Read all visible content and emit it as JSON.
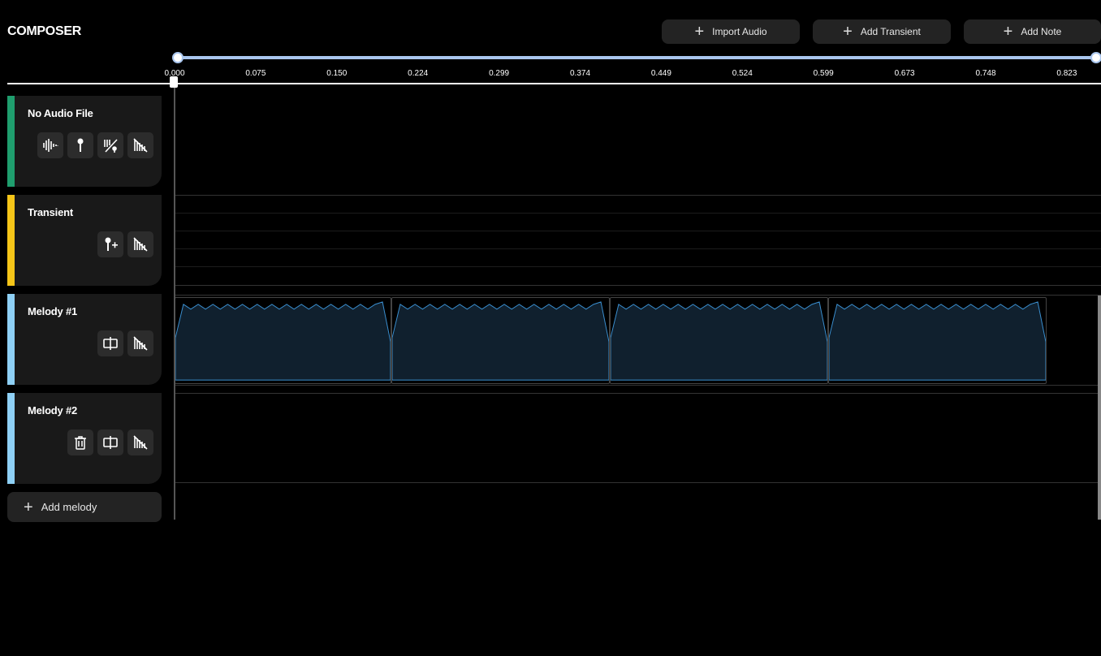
{
  "app": {
    "title": "COMPOSER"
  },
  "toolbar": {
    "import_audio": "Import Audio",
    "add_transient": "Add Transient",
    "add_note": "Add Note"
  },
  "timeline": {
    "ticks": [
      "0.000",
      "0.075",
      "0.150",
      "0.224",
      "0.299",
      "0.374",
      "0.449",
      "0.524",
      "0.599",
      "0.673",
      "0.748",
      "0.823"
    ]
  },
  "tracks": [
    {
      "name": "No Audio File",
      "color": "#1f9e6e",
      "icons": [
        "waveform-icon",
        "transient-pin-icon",
        "waveform-transient-icon",
        "mute-icon"
      ]
    },
    {
      "name": "Transient",
      "color": "#f5c518",
      "icons": [
        "add-transient-icon",
        "mute-icon"
      ]
    },
    {
      "name": "Melody #1",
      "color": "#8ed0f5",
      "icons": [
        "split-icon",
        "mute-icon"
      ]
    },
    {
      "name": "Melody #2",
      "color": "#8ed0f5",
      "icons": [
        "trash-icon",
        "split-icon",
        "mute-icon"
      ]
    }
  ],
  "add_melody": "Add melody",
  "colors": {
    "accent": "#a9c6ee",
    "clip_fill": "#10202e",
    "clip_line": "#3a8fd0"
  }
}
